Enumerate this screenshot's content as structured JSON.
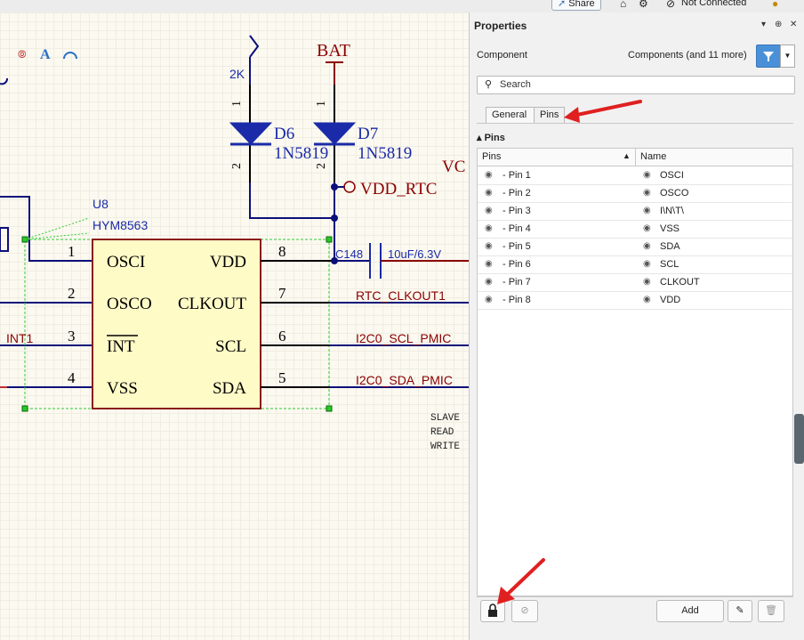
{
  "topbar": {
    "share_label": "Share",
    "connection_label": "Not Connected"
  },
  "schematic": {
    "component_designator": "U8",
    "component_value": "HYM8563",
    "pins_left": [
      {
        "number": "1",
        "name": "OSCI"
      },
      {
        "number": "2",
        "name": "OSCO"
      },
      {
        "number": "3",
        "name": "INT"
      },
      {
        "number": "4",
        "name": "VSS"
      }
    ],
    "pins_right": [
      {
        "number": "8",
        "name": "VDD"
      },
      {
        "number": "7",
        "name": "CLKOUT"
      },
      {
        "number": "6",
        "name": "SCL"
      },
      {
        "number": "5",
        "name": "SDA"
      }
    ],
    "diode1": {
      "ref": "D6",
      "value": "1N5819",
      "pin1": "1",
      "pin2": "2"
    },
    "diode2": {
      "ref": "D7",
      "value": "1N5819",
      "pin1": "1",
      "pin2": "2"
    },
    "resistor_value": "2K",
    "power_port": "BAT",
    "vdd_rtc_label": "VDD_RTC",
    "capacitor_ref": "C148",
    "capacitor_value": "10uF/6.3V",
    "net_clkout": "RTC_CLKOUT1",
    "net_scl": "I2C0_SCL_PMIC",
    "net_sda": "I2C0_SDA_PMIC",
    "net_int": "INT1",
    "partial_vc": "VC",
    "note_lines": [
      "SLAVE",
      "READ",
      "WRITE"
    ]
  },
  "panel": {
    "title": "Properties",
    "controls": [
      "▾",
      "⊕",
      "✕"
    ],
    "component_label": "Component",
    "filter_label": "Components (and 11 more)",
    "search_placeholder": "Search",
    "tabs": [
      {
        "label": "General"
      },
      {
        "label": "Pins"
      }
    ],
    "section_title": "Pins",
    "columns": {
      "pins": "Pins",
      "name": "Name"
    },
    "rows": [
      {
        "pin": "- Pin 1",
        "name": "OSCI"
      },
      {
        "pin": "- Pin 2",
        "name": "OSCO"
      },
      {
        "pin": "- Pin 3",
        "name": "I\\N\\T\\"
      },
      {
        "pin": "- Pin 4",
        "name": "VSS"
      },
      {
        "pin": "- Pin 5",
        "name": "SDA"
      },
      {
        "pin": "- Pin 6",
        "name": "SCL"
      },
      {
        "pin": "- Pin 7",
        "name": "CLKOUT"
      },
      {
        "pin": "- Pin 8",
        "name": "VDD"
      }
    ],
    "add_label": "Add"
  },
  "colors": {
    "accent": "#4a90d9",
    "annotation_arrow": "#e02020",
    "wire": "#0b0f7a",
    "component_fill": "#fffbc7",
    "component_border": "#8b1a1a",
    "net_label": "#8b0000"
  }
}
